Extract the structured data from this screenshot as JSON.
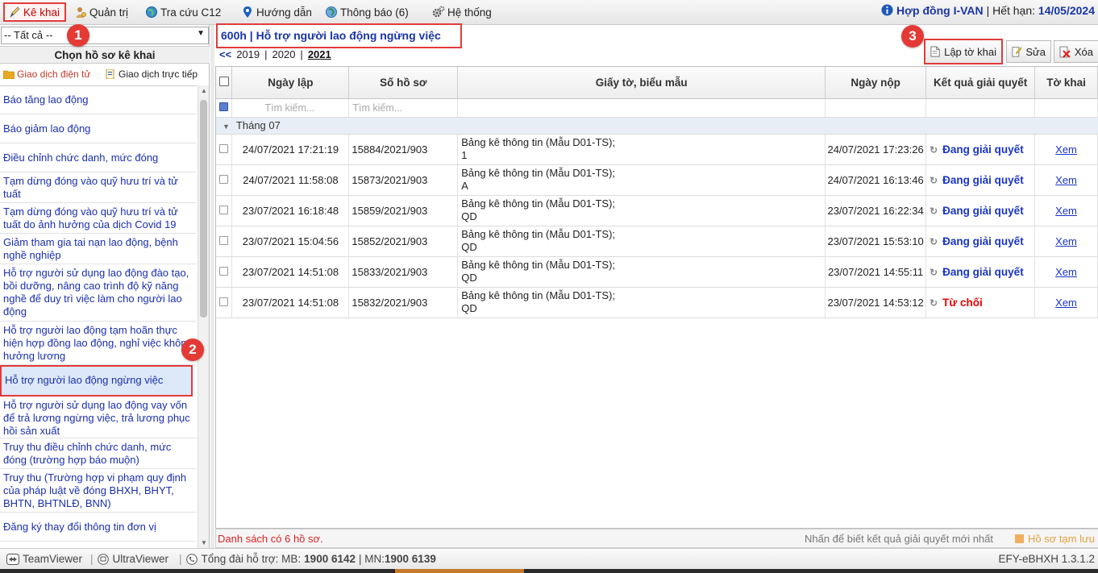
{
  "topmenu": {
    "items": [
      {
        "label": "Kê khai",
        "icon": "pencil-icon"
      },
      {
        "label": "Quản trị",
        "icon": "admin-icon"
      },
      {
        "label": "Tra cứu C12",
        "icon": "globe-icon"
      },
      {
        "label": "Hướng dẫn",
        "icon": "location-pin-icon"
      },
      {
        "label": "Thông báo (6)",
        "icon": "globe-notification-icon"
      },
      {
        "label": "Hệ thống",
        "icon": "gears-icon"
      }
    ],
    "contract_label": "Hợp đồng I-VAN",
    "sep": "|",
    "expiry_prefix": "Hết hạn:",
    "expiry_date": "14/05/2024"
  },
  "callouts": [
    "1",
    "2",
    "3"
  ],
  "left": {
    "filter_value": "-- Tất cả --",
    "title": "Chọn hồ sơ kê khai",
    "mode_electronic": "Giao dịch điện tử",
    "mode_direct": "Giao dịch trực tiếp",
    "items": [
      "Báo tăng lao động",
      "Báo giảm lao động",
      "Điều chỉnh chức danh, mức đóng",
      "Tạm dừng đóng vào quỹ hưu trí và tử tuất",
      "Tạm dừng đóng vào quỹ hưu trí và tử tuất do ảnh hưởng của dịch Covid 19",
      "Giảm tham gia tai nạn lao động, bệnh nghề nghiệp",
      "Hỗ trợ người sử dụng lao động đào tạo, bồi dưỡng, nâng cao trình độ kỹ năng nghề để duy trì việc làm cho người lao động",
      "Hỗ trợ người lao động tạm hoãn thực hiện hợp đồng lao động, nghỉ việc không hưởng lương",
      "Hỗ trợ người lao động ngừng việc",
      "Hỗ trợ người sử dụng lao động vay vốn để trả lương ngừng việc, trả lương phục hồi sản xuất",
      "Truy thu điều chỉnh chức danh, mức đóng (trường hợp báo muộn)",
      "Truy thu (Trường hợp vi phạm quy định của pháp luật về đóng BHXH, BHYT, BHTN, BHTNLĐ, BNN)",
      "Đăng ký thay đổi thông tin đơn vị"
    ]
  },
  "main": {
    "form_title": "600h | Hỗ trợ người lao động ngừng việc",
    "years_nav": "<<",
    "years": [
      "2019",
      "2020",
      "2021"
    ],
    "year_sep": "|",
    "buttons": {
      "create": "Lập tờ khai",
      "edit": "Sửa",
      "delete": "Xóa"
    },
    "columns": [
      "Ngày lập",
      "Số hồ sơ",
      "Giấy tờ, biểu mẫu",
      "Ngày nộp",
      "Kết quả giải quyết",
      "Tờ khai"
    ],
    "search_placeholder": "Tìm kiếm...",
    "group_label": "Tháng 07",
    "rows": [
      {
        "created": "24/07/2021 17:21:19",
        "id": "15884/2021/903",
        "doc1": "Bảng kê thông tin (Mẫu D01-TS);",
        "doc2": "1",
        "submitted": "24/07/2021 17:23:26",
        "status": "Đang giải quyết",
        "status_type": "processing",
        "link": "Xem"
      },
      {
        "created": "24/07/2021 11:58:08",
        "id": "15873/2021/903",
        "doc1": "Bảng kê thông tin (Mẫu D01-TS);",
        "doc2": "A",
        "submitted": "24/07/2021 16:13:46",
        "status": "Đang giải quyết",
        "status_type": "processing",
        "link": "Xem"
      },
      {
        "created": "23/07/2021 16:18:48",
        "id": "15859/2021/903",
        "doc1": "Bảng kê thông tin (Mẫu D01-TS);",
        "doc2": "QD",
        "submitted": "23/07/2021 16:22:34",
        "status": "Đang giải quyết",
        "status_type": "processing",
        "link": "Xem"
      },
      {
        "created": "23/07/2021 15:04:56",
        "id": "15852/2021/903",
        "doc1": "Bảng kê thông tin (Mẫu D01-TS);",
        "doc2": "QD",
        "submitted": "23/07/2021 15:53:10",
        "status": "Đang giải quyết",
        "status_type": "processing",
        "link": "Xem"
      },
      {
        "created": "23/07/2021 14:51:08",
        "id": "15833/2021/903",
        "doc1": "Bảng kê thông tin (Mẫu D01-TS);",
        "doc2": "QD",
        "submitted": "23/07/2021 14:55:11",
        "status": "Đang giải quyết",
        "status_type": "processing",
        "link": "Xem"
      },
      {
        "created": "23/07/2021 14:51:08",
        "id": "15832/2021/903",
        "doc1": "Bảng kê thông tin (Mẫu D01-TS);",
        "doc2": "QD",
        "submitted": "23/07/2021 14:53:12",
        "status": "Từ chối",
        "status_type": "rejected",
        "link": "Xem"
      }
    ],
    "footer_count": "Danh sách có 6 hồ sơ.",
    "footer_hint": "Nhấn để biết kết quả giải quyết mới nhất",
    "footer_saved": "Hồ sơ tạm lưu"
  },
  "statusbar": {
    "teamviewer": "TeamViewer",
    "ultraviewer": "UltraViewer",
    "hotline_prefix": "Tổng đài hỗ trợ: MB:",
    "hotline_mb": "1900 6142",
    "hotline_sep": "| MN:",
    "hotline_mn": "1900 6139",
    "version": "EFY-eBHXH 1.3.1.2"
  },
  "colors": {
    "accent_blue": "#1a34c6",
    "callout_red": "#e53935",
    "rejected": "#e00000"
  }
}
